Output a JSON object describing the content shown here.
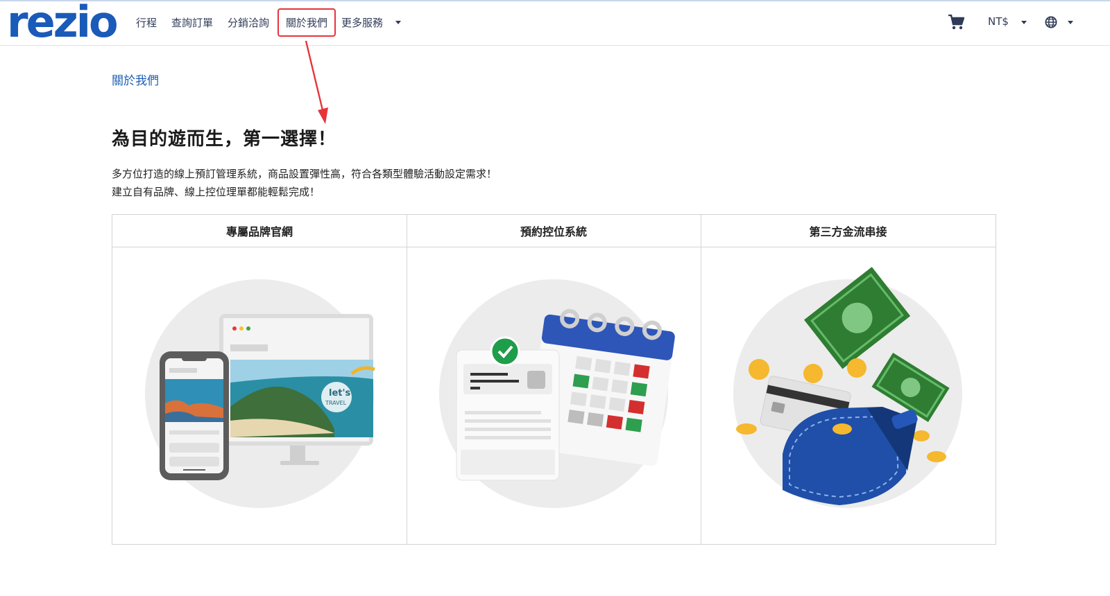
{
  "header": {
    "logo": "rezio",
    "nav": [
      {
        "label": "行程"
      },
      {
        "label": "查詢訂單"
      },
      {
        "label": "分銷洽詢"
      },
      {
        "label": "關於我們"
      },
      {
        "label": "更多服務"
      }
    ],
    "currency": "NT$",
    "icons": {
      "cart": "cart-icon",
      "language": "globe-icon",
      "dropdown": "caret-down-icon"
    }
  },
  "page": {
    "breadcrumb": "關於我們",
    "headline": "為目的遊而生，第一選擇！",
    "description_lines": [
      "多方位打造的線上預訂管理系統，商品設置彈性高，符合各類型體驗活動設定需求！",
      "建立自有品牌、線上控位理單都能輕鬆完成！"
    ]
  },
  "features": [
    {
      "title": "專屬品牌官網",
      "illustration": "website-devices-illustration"
    },
    {
      "title": "預約控位系統",
      "illustration": "booking-calendar-illustration"
    },
    {
      "title": "第三方金流串接",
      "illustration": "payment-wallet-illustration"
    }
  ],
  "illustration_text": {
    "lets_travel": "let's",
    "travel": "TRAVEL"
  },
  "colors": {
    "brand": "#1a5ab8",
    "highlight": "#e5343a",
    "link": "#1d5fb5"
  }
}
